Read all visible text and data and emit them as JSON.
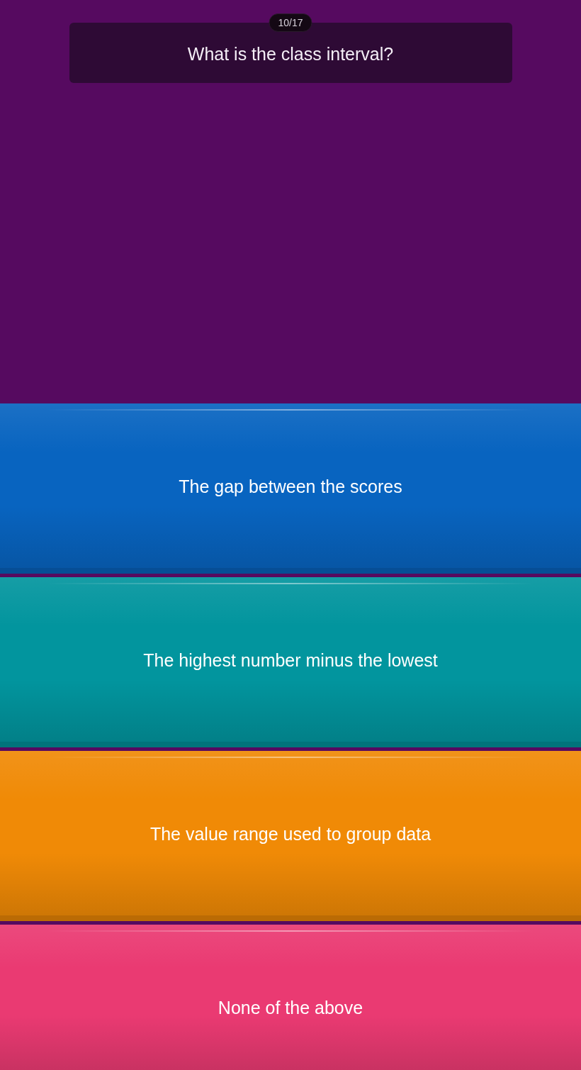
{
  "progress": "10/17",
  "question": "What is the class interval?",
  "options": [
    {
      "label": "The gap between the scores",
      "color": "#0864c0"
    },
    {
      "label": "The highest number minus the lowest",
      "color": "#02959e"
    },
    {
      "label": "The value range used to group data",
      "color": "#f08a06"
    },
    {
      "label": "None of the above",
      "color": "#ea3a72"
    }
  ]
}
